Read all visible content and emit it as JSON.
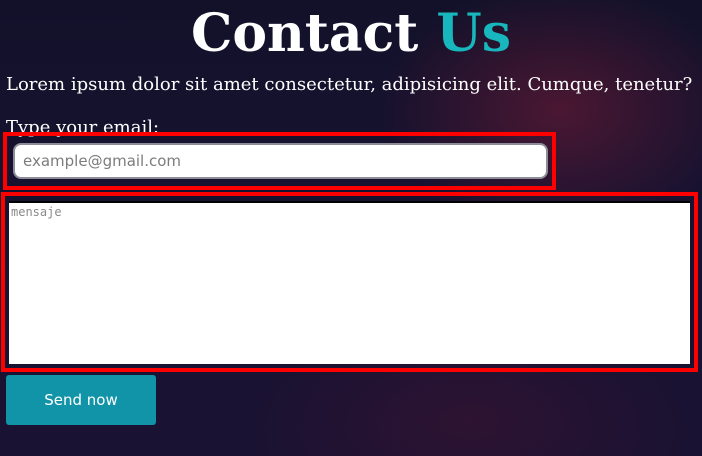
{
  "header": {
    "title_main": "Contact",
    "title_accent": "Us",
    "accent_color": "#17b7bd"
  },
  "intro": {
    "text": "Lorem ipsum dolor sit amet consectetur, adipisicing elit. Cumque, tenetur?"
  },
  "form": {
    "email_label": "Type your email:",
    "email_placeholder": "example@gmail.com",
    "message_placeholder": "mensaje",
    "send_label": "Send now",
    "send_color": "#1194a7",
    "highlight_color": "#ff0000"
  }
}
